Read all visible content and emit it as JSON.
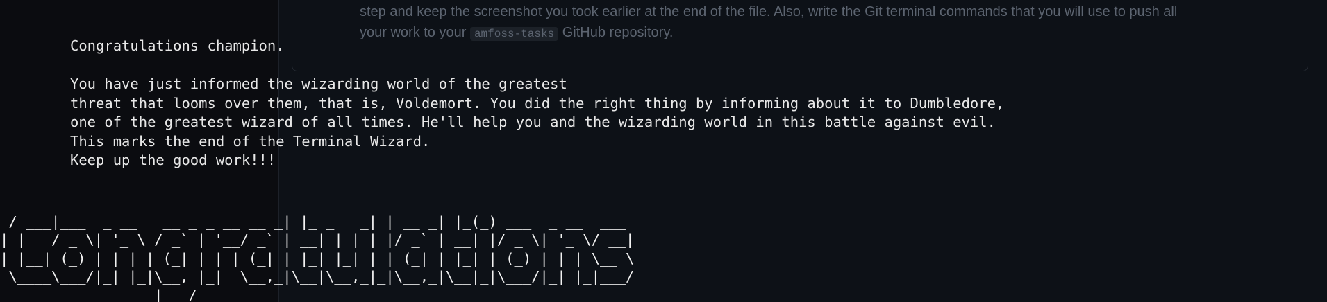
{
  "browser_background": {
    "instruction_line_1": "step and keep the screenshot you took earlier at the end of the file. Also, write the Git terminal commands that you will use to push all",
    "instruction_line_2_prefix": "your work to your ",
    "repo_code": "amfoss-tasks",
    "instruction_line_2_suffix": " GitHub repository."
  },
  "terminal": {
    "lines": [
      "Congratulations champion.",
      "",
      "You have just informed the wizarding world of the greatest",
      "threat that looms over them, that is, Voldemort. You did the right thing by informing about it to Dumbledore,",
      "one of the greatest wizard of all times. He'll help you and the wizarding world in this battle against evil.",
      "This marks the end of the Terminal Wizard.",
      "Keep up the good work!!!"
    ],
    "ascii_art": "     ____                            _         _       _   _\n / ___|___  _ __   __ _ _ __ __ _| |_ _   _| | __ _| |_(_) ___  _ __  ___\n| |   / _ \\| '_ \\ / _` | '__/ _` | __| | | | |/ _` | __| |/ _ \\| '_ \\/ __|\n| |__| (_) | | | | (_| | | | (_| | |_| |_| | | (_| | |_| | (_) | | | \\__ \\\n \\____\\___/|_| |_|\\__, |_|  \\__,_|\\__|\\__,_|_|\\__,_|\\__|_|\\___/|_| |_|___/\n                  |___/"
  },
  "colors": {
    "terminal_bg": "#0b0c10",
    "terminal_text": "#e8e8e8",
    "muted_text": "#5c6470"
  }
}
